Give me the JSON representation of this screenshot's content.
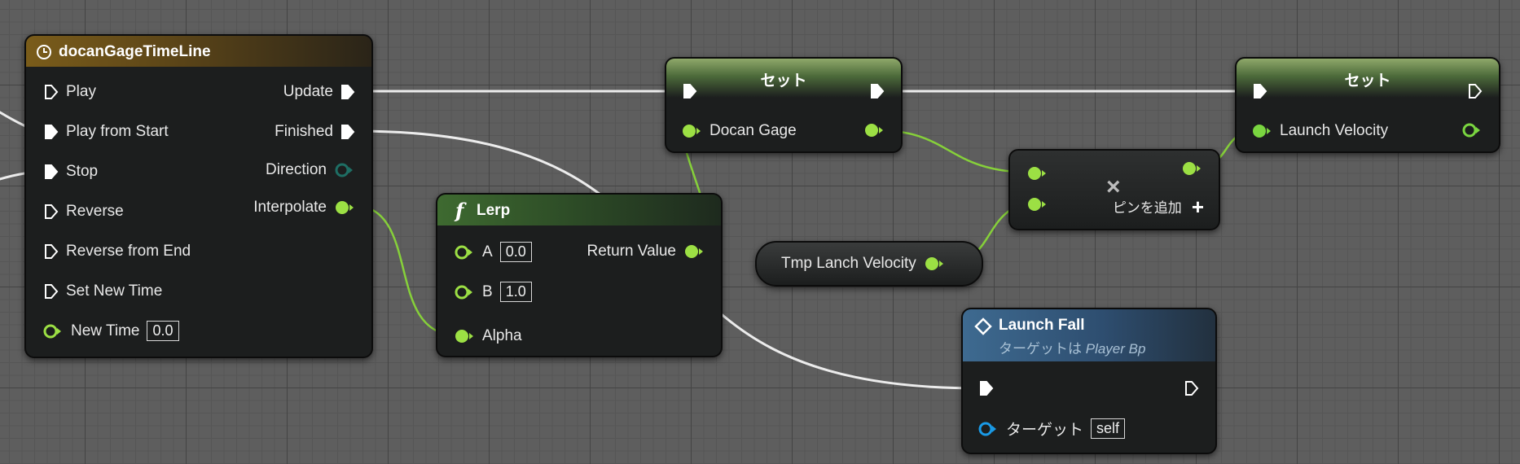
{
  "timeline": {
    "title": "docanGageTimeLine",
    "inputs": [
      {
        "label": "Play",
        "filled": false
      },
      {
        "label": "Play from Start",
        "filled": true
      },
      {
        "label": "Stop",
        "filled": true
      },
      {
        "label": "Reverse",
        "filled": false
      },
      {
        "label": "Reverse from End",
        "filled": false
      },
      {
        "label": "Set New Time",
        "filled": false
      }
    ],
    "new_time": {
      "label": "New Time",
      "value": "0.0"
    },
    "outputs": [
      "Update",
      "Finished",
      "Direction",
      "Interpolate"
    ]
  },
  "lerp": {
    "title": "Lerp",
    "icon": "f",
    "a": {
      "label": "A",
      "value": "0.0"
    },
    "b": {
      "label": "B",
      "value": "1.0"
    },
    "alpha": "Alpha",
    "return_value": "Return Value"
  },
  "set1": {
    "title": "セット",
    "pin": "Docan Gage"
  },
  "set2": {
    "title": "セット",
    "pin": "Launch Velocity"
  },
  "multiply": {
    "symbol": "×",
    "add_pin": "ピンを追加",
    "plus": "+"
  },
  "tmp": {
    "label": "Tmp Lanch Velocity"
  },
  "launch_fall": {
    "title": "Launch Fall",
    "target_prefix": "ターゲットは",
    "target_class": "Player Bp",
    "target_label": "ターゲット",
    "target_value": "self"
  },
  "colors": {
    "float_pin": "#9ce044",
    "struct_pin": "#7ad640",
    "object_pin": "#1a9ae6",
    "exec_pin": "#ffffff",
    "direction_pin": "#1e6e64"
  }
}
